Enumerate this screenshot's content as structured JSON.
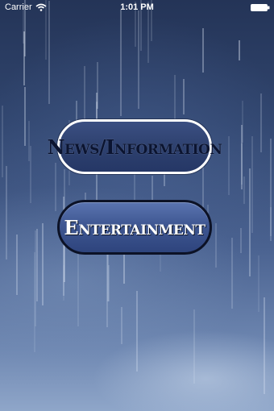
{
  "status_bar": {
    "carrier": "Carrier",
    "time": "1:01 PM",
    "wifi_icon": "wifi-icon",
    "battery_icon": "battery-icon"
  },
  "menu": {
    "buttons": [
      {
        "label": "News/Information",
        "style": "outlined-white"
      },
      {
        "label": "Entertainment",
        "style": "filled-blue"
      }
    ]
  },
  "colors": {
    "background_top": "#243457",
    "background_bottom": "#8fa6c9",
    "news_button_fill": "#2e416f",
    "news_button_border": "#ffffff",
    "entertainment_button_fill": "#3f5792",
    "entertainment_button_border": "#0c1226"
  }
}
